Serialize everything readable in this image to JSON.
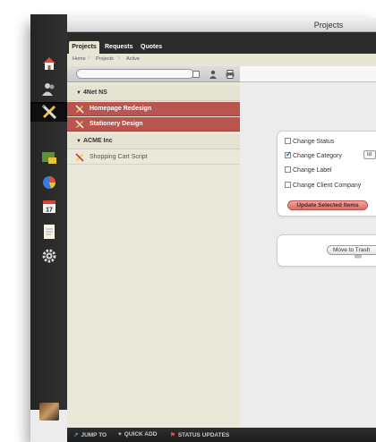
{
  "window": {
    "title": "Projects"
  },
  "tabs": [
    {
      "label": "Projects",
      "selected": true
    },
    {
      "label": "Requests",
      "selected": false
    },
    {
      "label": "Quotes",
      "selected": false
    }
  ],
  "breadcrumb": [
    "Home",
    "Projects",
    "Active"
  ],
  "sidebar": {
    "icons": [
      "home-icon",
      "contacts-icon",
      "projects-icon",
      "reports-icon",
      "chart-icon",
      "calendar-icon",
      "notes-icon",
      "settings-icon"
    ],
    "calendar_day": "17"
  },
  "groups": [
    {
      "label": "4Net NS",
      "count": "2",
      "items": [
        {
          "label": "Homepage Redesign",
          "selected": true
        },
        {
          "label": "Stationery Design",
          "selected": true
        }
      ]
    },
    {
      "label": "ACME Inc",
      "count": "1",
      "items": [
        {
          "label": "Shopping Cart Script",
          "selected": false
        }
      ]
    }
  ],
  "batch": {
    "options": [
      {
        "label": "Change Status",
        "checked": false
      },
      {
        "label": "Change Category",
        "checked": true
      },
      {
        "label": "Change Label",
        "checked": false
      },
      {
        "label": "Change Client Company",
        "checked": false
      }
    ],
    "category_select": "Id",
    "update_label": "Update Selected Items",
    "trash_label": "Move to Trash"
  },
  "bottombar": {
    "jump_to": "JUMP TO",
    "quick_add": "QUICK ADD",
    "status_updates": "STATUS UPDATES"
  },
  "colors": {
    "accent": "#b8554f",
    "sidebar": "#2b2b2b",
    "list_bg": "#e9e8d9"
  }
}
